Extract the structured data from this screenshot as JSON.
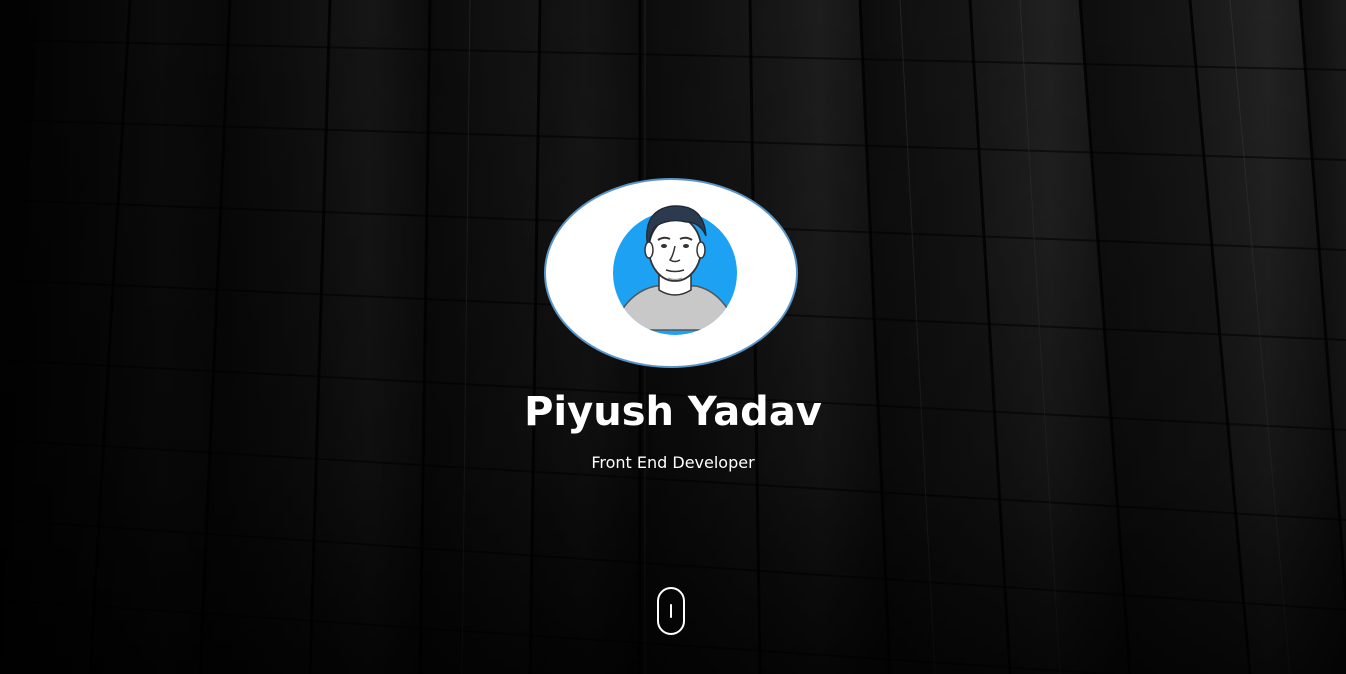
{
  "hero": {
    "name": "Piyush Yadav",
    "role": "Front End Developer"
  },
  "avatar": {
    "icon": "developer-avatar-icon",
    "frame_color": "#5a95c8",
    "circle_color": "#1da1f2"
  },
  "scroll_indicator": {
    "icon": "scroll-mouse-icon"
  },
  "background": {
    "description_icon": "dark-building-background"
  }
}
